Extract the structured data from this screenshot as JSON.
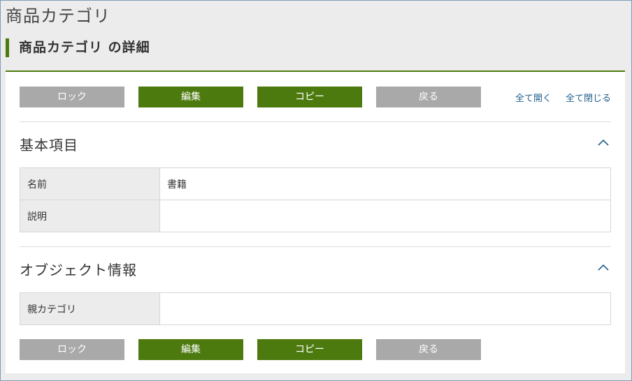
{
  "page": {
    "title": "商品カテゴリ",
    "subtitle": "商品カテゴリ の詳細"
  },
  "toolbar": {
    "lock_label": "ロック",
    "edit_label": "編集",
    "copy_label": "コピー",
    "back_label": "戻る",
    "expand_all_label": "全て開く",
    "collapse_all_label": "全て閉じる"
  },
  "sections": [
    {
      "title": "基本項目",
      "rows": [
        {
          "label": "名前",
          "value": "書籍"
        },
        {
          "label": "説明",
          "value": ""
        }
      ]
    },
    {
      "title": "オブジェクト情報",
      "rows": [
        {
          "label": "親カテゴリ",
          "value": ""
        }
      ]
    }
  ],
  "colors": {
    "accent_green": "#4d7a0f",
    "button_gray": "#a9a9a9",
    "link_blue": "#1f5f8b",
    "background": "#ececec"
  },
  "icons": {
    "collapse": "chevron-up-icon"
  }
}
